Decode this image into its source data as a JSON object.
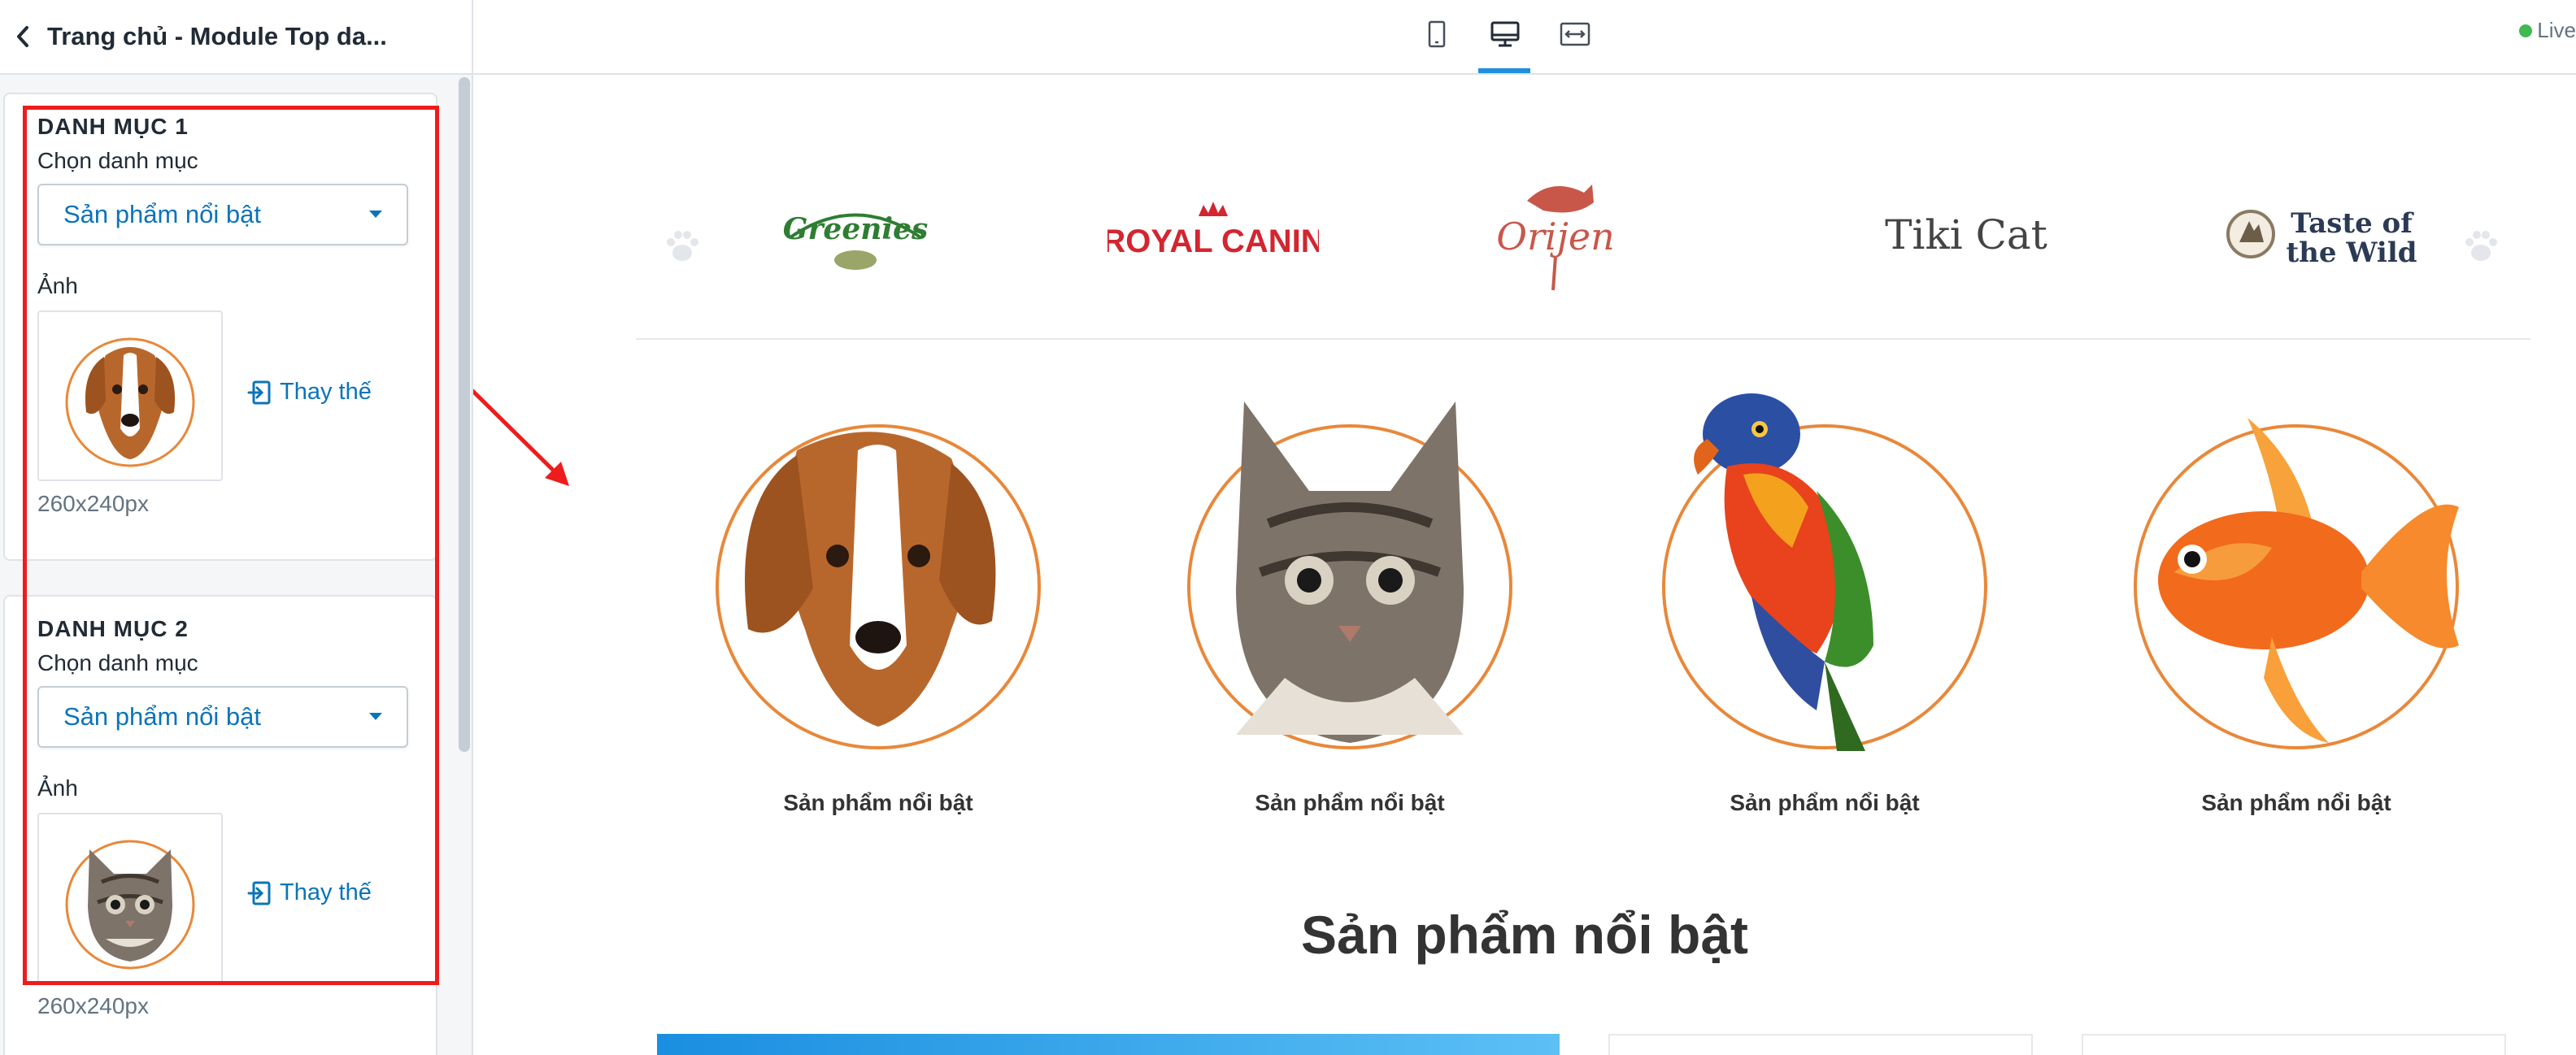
{
  "editor": {
    "title": "Trang chủ - Module Top da...",
    "live_label": "Live",
    "view_modes": [
      {
        "name": "mobile",
        "icon": "mobile-icon",
        "active": false
      },
      {
        "name": "desktop",
        "icon": "desktop-icon",
        "active": true
      },
      {
        "name": "full-width",
        "icon": "full-width-icon",
        "active": false
      }
    ],
    "accent_color": "#0b74b8",
    "annotation_color": "#ee1c1c"
  },
  "sidebar": {
    "categories": [
      {
        "heading": "DANH MỤC 1",
        "select_label": "Chọn danh mục",
        "select_value": "Sản phẩm nổi bật",
        "image_label": "Ảnh",
        "image": "dog-image",
        "replace_label": "Thay thế",
        "size_hint": "260x240px"
      },
      {
        "heading": "DANH MỤC 2",
        "select_label": "Chọn danh mục",
        "select_value": "Sản phẩm nổi bật",
        "image_label": "Ảnh",
        "image": "cat-image",
        "replace_label": "Thay thế",
        "size_hint": "260x240px"
      }
    ]
  },
  "preview": {
    "brands": [
      {
        "name": "Greenies",
        "color": "#2e7d32"
      },
      {
        "name": "ROYAL CANIN",
        "color": "#d22630"
      },
      {
        "name": "Orijen",
        "color": "#c8574a"
      },
      {
        "name": "Tiki Cat",
        "color": "#444444"
      },
      {
        "name": "Taste of the Wild",
        "color": "#2b3a55"
      }
    ],
    "categories": [
      {
        "label": "Sản phẩm nổi bật",
        "image": "dog-image"
      },
      {
        "label": "Sản phẩm nổi bật",
        "image": "cat-image"
      },
      {
        "label": "Sản phẩm nổi bật",
        "image": "parrot-image"
      },
      {
        "label": "Sản phẩm nổi bật",
        "image": "goldfish-image"
      }
    ],
    "circle_color": "#e8883a",
    "section_title": "Sản phẩm nổi bật"
  }
}
